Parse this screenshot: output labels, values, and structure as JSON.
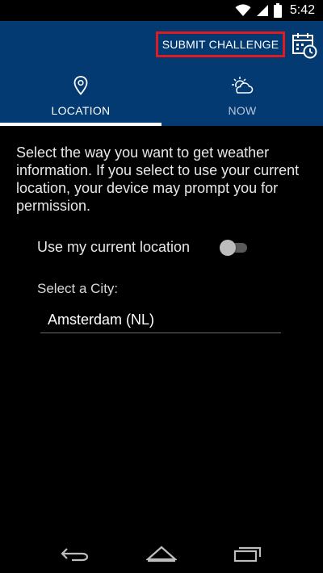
{
  "status_bar": {
    "time": "5:42",
    "icons": [
      "wifi-icon",
      "cell-signal-icon",
      "battery-icon"
    ]
  },
  "app_bar": {
    "submit_label": "SUBMIT CHALLENGE",
    "calendar_icon": "calendar-clock-icon",
    "background_color": "#043a72",
    "highlight_color": "#e11a22"
  },
  "tabs": [
    {
      "label": "LOCATION",
      "icon": "location-pin-icon",
      "active": true
    },
    {
      "label": "NOW",
      "icon": "sun-cloud-icon",
      "active": false
    }
  ],
  "content": {
    "intro": "Select the way you want to get weather information. If you select to use your current location, your device may prompt you for permission.",
    "use_location_label": "Use my current location",
    "use_location_enabled": false,
    "city_label": "Select a City:",
    "city_value": "Amsterdam (NL)"
  },
  "nav_bar": {
    "icons": [
      "back-icon",
      "home-icon",
      "recents-icon"
    ]
  }
}
